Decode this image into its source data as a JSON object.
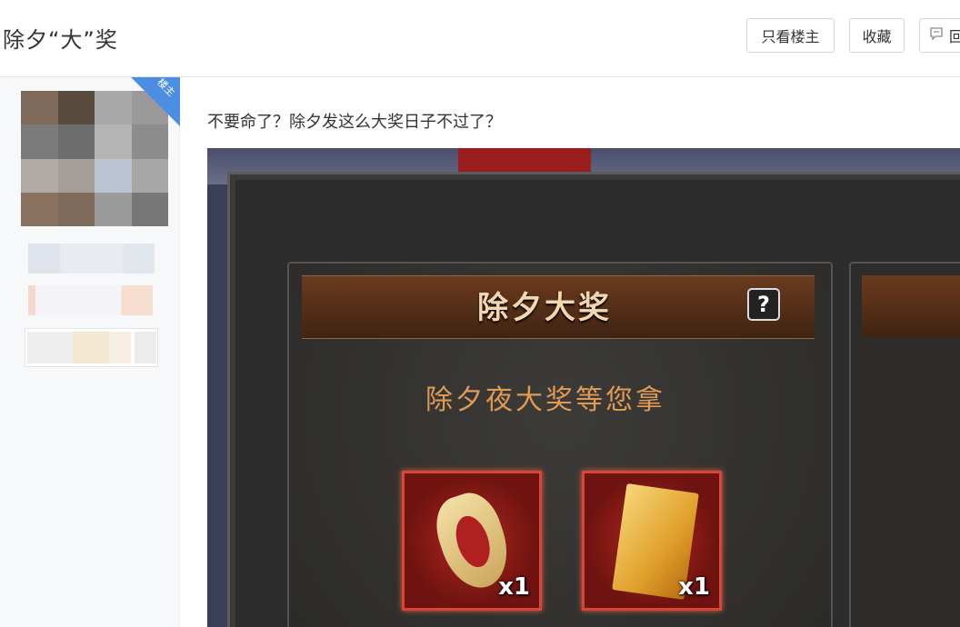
{
  "header": {
    "title": "除夕“大”奖",
    "buttons": {
      "only_op": "只看楼主",
      "favorite": "收藏",
      "reply": "回"
    }
  },
  "sidebar": {
    "ribbon_text": "楼主"
  },
  "post": {
    "text": "不要命了？除夕发这么大奖日子不过了？"
  },
  "game_screenshot": {
    "panel_title": "除夕大奖",
    "help_label": "?",
    "subtitle": "除夕夜大奖等您拿",
    "items": [
      {
        "qty": "x1"
      },
      {
        "qty": "x1"
      }
    ]
  }
}
